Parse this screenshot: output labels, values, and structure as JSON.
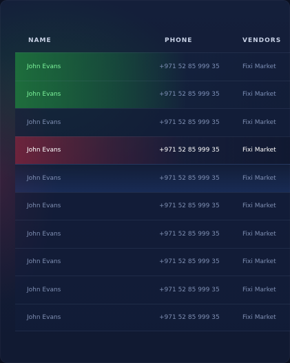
{
  "table": {
    "headers": {
      "name": "NAME",
      "phone": "PHONE",
      "vendors": "VENDORS"
    },
    "rows": [
      {
        "name": "John Evans",
        "phone": "+971 52 85 999 35",
        "vendor": "Fixi Market",
        "highlight": "green"
      },
      {
        "name": "John Evans",
        "phone": "+971 52 85 999 35",
        "vendor": "Fixi Market",
        "highlight": "green"
      },
      {
        "name": "John Evans",
        "phone": "+971 52 85 999 35",
        "vendor": "Fixi Market",
        "highlight": "none"
      },
      {
        "name": "John Evans",
        "phone": "+971 52 85 999 35",
        "vendor": "Fixi Market",
        "highlight": "red"
      },
      {
        "name": "John Evans",
        "phone": "+971 52 85 999 35",
        "vendor": "Fixi Market",
        "highlight": "blue"
      },
      {
        "name": "John Evans",
        "phone": "+971 52 85 999 35",
        "vendor": "Fixi Market",
        "highlight": "none"
      },
      {
        "name": "John Evans",
        "phone": "+971 52 85 999 35",
        "vendor": "Fixi Market",
        "highlight": "none"
      },
      {
        "name": "John Evans",
        "phone": "+971 52 85 999 35",
        "vendor": "Fixi Market",
        "highlight": "none"
      },
      {
        "name": "John Evans",
        "phone": "+971 52 85 999 35",
        "vendor": "Fixi Market",
        "highlight": "none"
      },
      {
        "name": "John Evans",
        "phone": "+971 52 85 999 35",
        "vendor": "Fixi Market",
        "highlight": "none"
      }
    ]
  },
  "colors": {
    "background": "#121c35",
    "header_text": "#c9d2e6",
    "muted_text": "#7f8fb2",
    "green_accent": "#6de28a",
    "red_accent": "#7a2540"
  }
}
